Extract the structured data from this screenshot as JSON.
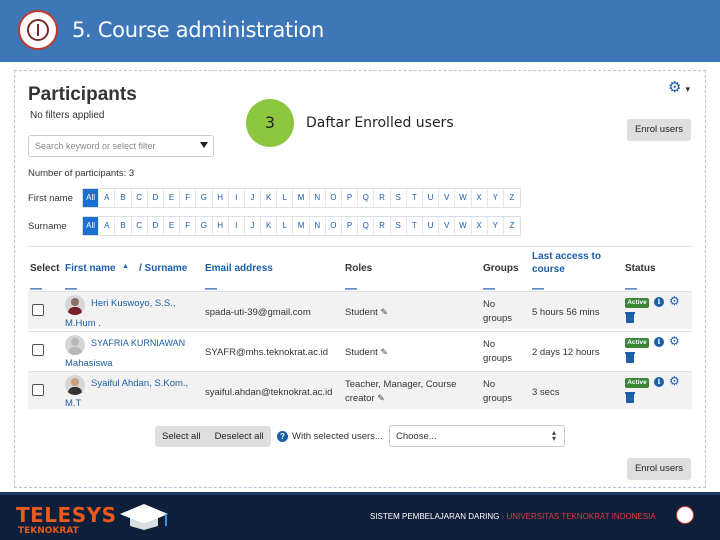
{
  "slide": {
    "title": "5. Course administration"
  },
  "participants": {
    "heading": "Participants",
    "filters_text": "No filters applied",
    "search_placeholder": "Search keyword or select filter",
    "enrol_button": "Enrol users",
    "count_text": "Number of participants: 3",
    "first_name_label": "First name",
    "surname_label": "Surname",
    "letters": [
      "All",
      "A",
      "B",
      "C",
      "D",
      "E",
      "F",
      "G",
      "H",
      "I",
      "J",
      "K",
      "L",
      "M",
      "N",
      "O",
      "P",
      "Q",
      "R",
      "S",
      "T",
      "U",
      "V",
      "W",
      "X",
      "Y",
      "Z"
    ]
  },
  "annotation": {
    "step": "3",
    "caption": "Daftar Enrolled users"
  },
  "table": {
    "columns": {
      "select": "Select",
      "first_name": "First name",
      "sort_arrow": "▲",
      "slash_surname": "/ Surname",
      "email": "Email address",
      "roles": "Roles",
      "groups": "Groups",
      "last_access": "Last access to course",
      "status": "Status"
    },
    "rows": [
      {
        "name_line1": "Heri Kuswoyo, S.S.,",
        "name_line2": "M.Hum .",
        "email": "spada-uti-39@gmail.com",
        "roles": "Student",
        "groups_line1": "No",
        "groups_line2": "groups",
        "last_access": "5 hours 56 mins",
        "status": "Active"
      },
      {
        "name_line1": "SYAFRIA KURNIAWAN",
        "name_line2": "Mahasiswa",
        "email": "SYAFR@mhs.teknokrat.ac.id",
        "roles": "Student",
        "groups_line1": "No",
        "groups_line2": "groups",
        "last_access": "2 days 12 hours",
        "status": "Active"
      },
      {
        "name_line1": "Syaiful Ahdan, S.Kom.,",
        "name_line2": "M.T",
        "email": "syaiful.ahdan@teknokrat.ac.id",
        "roles_line1": "Teacher, Manager, Course",
        "roles_line2": "creator",
        "groups_line1": "No",
        "groups_line2": "groups",
        "last_access": "3 secs",
        "status": "Active"
      }
    ]
  },
  "bulk": {
    "select_all": "Select all",
    "deselect_all": "Deselect all",
    "with_selected": "With selected users...",
    "choose": "Choose..."
  },
  "footer": {
    "brand": "TELESYS",
    "brand_sub": "TEKNOKRAT",
    "text_left": "SISTEM PEMBELAJARAN DARING",
    "separator": "-",
    "text_right": "UNIVERSITAS TEKNOKRAT INDONESIA"
  },
  "colors": {
    "header_blue": "#3d77b8",
    "link_blue": "#1b5fa8",
    "step_green": "#8cc63f",
    "active_green": "#398439",
    "footer_navy": "#0d1f3a",
    "brand_orange": "#e85a1e"
  }
}
